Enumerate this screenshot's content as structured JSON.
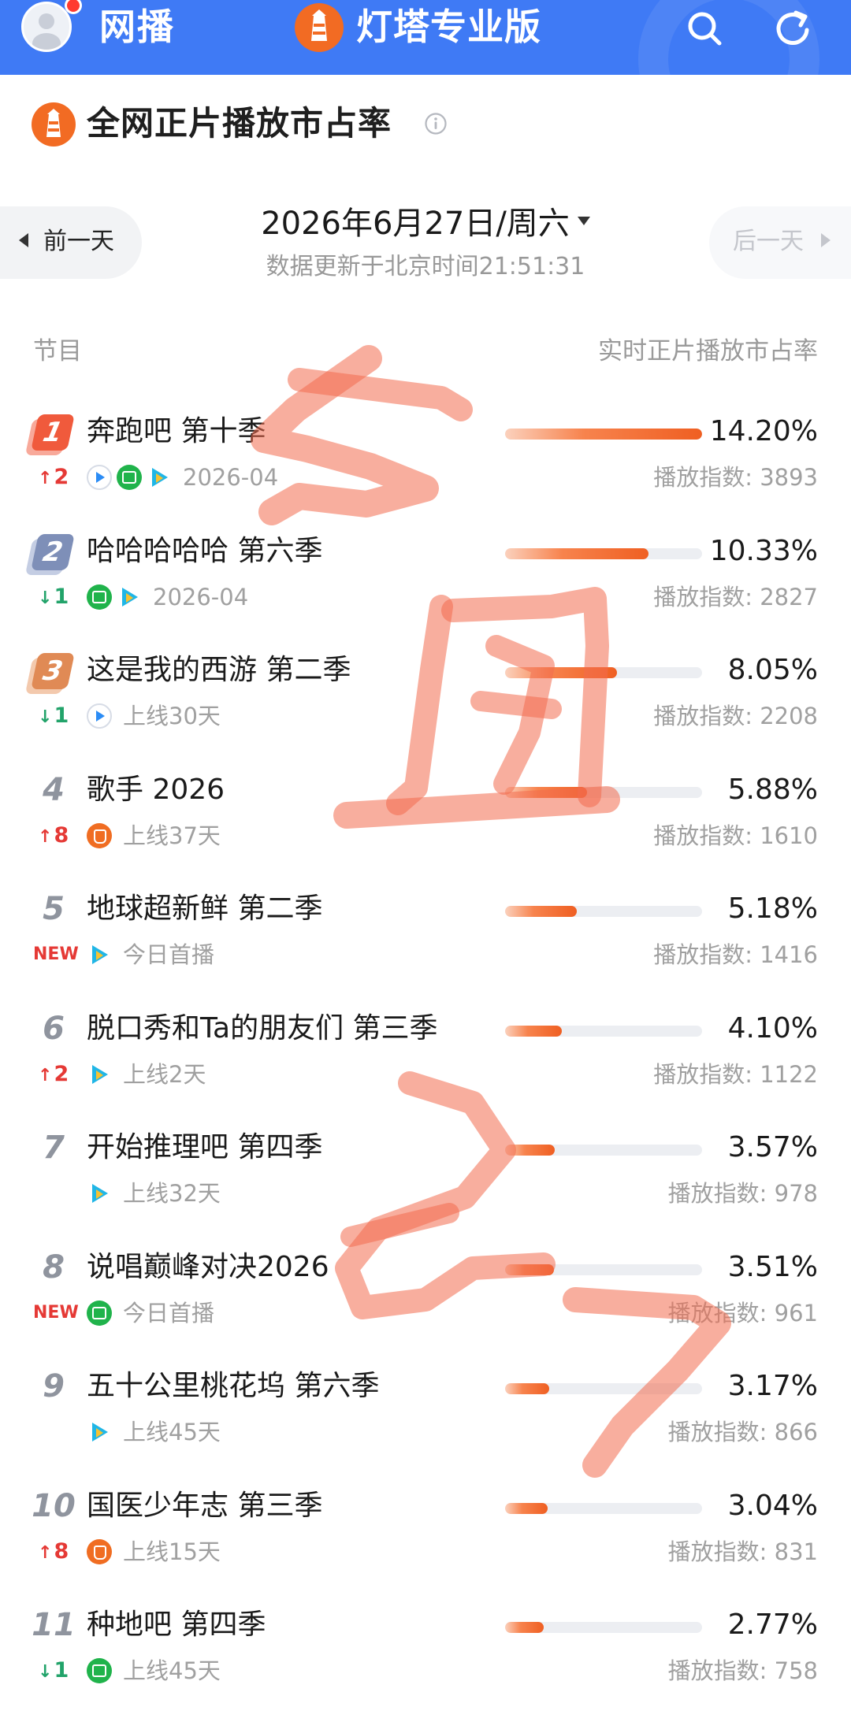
{
  "topbar": {
    "tab": "网播",
    "brand": "灯塔专业版"
  },
  "header": {
    "title": "全网正片播放市占率"
  },
  "date_nav": {
    "prev": "前一天",
    "date": "2026年6月27日/周六",
    "updated": "数据更新于北京时间21:51:31",
    "next": "后一天"
  },
  "columns": {
    "left": "节目",
    "right": "实时正片播放市占率"
  },
  "rows": [
    {
      "rank": "1",
      "title": "奔跑吧 第十季",
      "change_dir": "up",
      "change": "2",
      "platforms": [
        "youku",
        "iqiyi",
        "tencent"
      ],
      "meta": "2026-04",
      "share": "14.20%",
      "share_value": 14.2,
      "index": "播放指数: 3893"
    },
    {
      "rank": "2",
      "title": "哈哈哈哈哈 第六季",
      "change_dir": "down",
      "change": "1",
      "platforms": [
        "iqiyi",
        "tencent"
      ],
      "meta": "2026-04",
      "share": "10.33%",
      "share_value": 10.33,
      "index": "播放指数: 2827"
    },
    {
      "rank": "3",
      "title": "这是我的西游 第二季",
      "change_dir": "down",
      "change": "1",
      "platforms": [
        "youku"
      ],
      "meta": "上线30天",
      "share": "8.05%",
      "share_value": 8.05,
      "index": "播放指数: 2208"
    },
    {
      "rank": "4",
      "title": "歌手 2026",
      "change_dir": "up",
      "change": "8",
      "platforms": [
        "mango"
      ],
      "meta": "上线37天",
      "share": "5.88%",
      "share_value": 5.88,
      "index": "播放指数: 1610"
    },
    {
      "rank": "5",
      "title": "地球超新鲜 第二季",
      "change_dir": "new",
      "change": "NEW",
      "platforms": [
        "tencent"
      ],
      "meta": "今日首播",
      "share": "5.18%",
      "share_value": 5.18,
      "index": "播放指数: 1416"
    },
    {
      "rank": "6",
      "title": "脱口秀和Ta的朋友们 第三季",
      "change_dir": "up",
      "change": "2",
      "platforms": [
        "tencent"
      ],
      "meta": "上线2天",
      "share": "4.10%",
      "share_value": 4.1,
      "index": "播放指数: 1122"
    },
    {
      "rank": "7",
      "title": "开始推理吧 第四季",
      "change_dir": "none",
      "change": "",
      "platforms": [
        "tencent"
      ],
      "meta": "上线32天",
      "share": "3.57%",
      "share_value": 3.57,
      "index": "播放指数: 978"
    },
    {
      "rank": "8",
      "title": "说唱巅峰对决2026",
      "change_dir": "new",
      "change": "NEW",
      "platforms": [
        "iqiyi"
      ],
      "meta": "今日首播",
      "share": "3.51%",
      "share_value": 3.51,
      "index": "播放指数: 961"
    },
    {
      "rank": "9",
      "title": "五十公里桃花坞 第六季",
      "change_dir": "none",
      "change": "",
      "platforms": [
        "tencent"
      ],
      "meta": "上线45天",
      "share": "3.17%",
      "share_value": 3.17,
      "index": "播放指数: 866"
    },
    {
      "rank": "10",
      "title": "国医少年志 第三季",
      "change_dir": "up",
      "change": "8",
      "platforms": [
        "mango"
      ],
      "meta": "上线15天",
      "share": "3.04%",
      "share_value": 3.04,
      "index": "播放指数: 831"
    },
    {
      "rank": "11",
      "title": "种地吧 第四季",
      "change_dir": "down",
      "change": "1",
      "platforms": [
        "iqiyi"
      ],
      "meta": "上线45天",
      "share": "2.77%",
      "share_value": 2.77,
      "index": "播放指数: 758"
    }
  ],
  "colors": {
    "topbar": "#3f7af5",
    "brand_orange": "#f26b23",
    "up": "#e53935",
    "down": "#22a36a",
    "overlay": "#f26b4f"
  }
}
